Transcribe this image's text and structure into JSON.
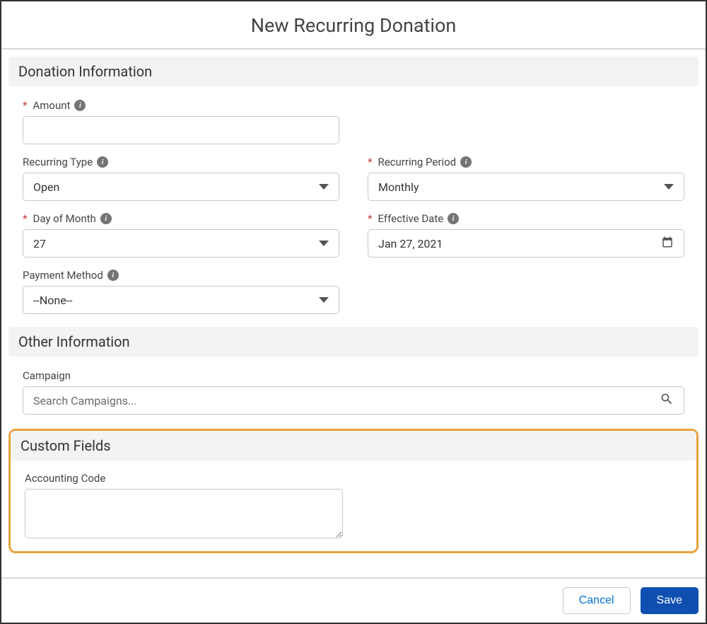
{
  "header": {
    "title": "New Recurring Donation"
  },
  "sections": {
    "donation": {
      "title": "Donation Information"
    },
    "other": {
      "title": "Other Information"
    },
    "custom": {
      "title": "Custom Fields"
    }
  },
  "fields": {
    "amount": {
      "label": "Amount",
      "required": true,
      "value": ""
    },
    "recurring_type": {
      "label": "Recurring Type",
      "value": "Open"
    },
    "recurring_period": {
      "label": "Recurring Period",
      "required": true,
      "value": "Monthly"
    },
    "day_of_month": {
      "label": "Day of Month",
      "required": true,
      "value": "27"
    },
    "effective_date": {
      "label": "Effective Date",
      "required": true,
      "value": "Jan 27, 2021"
    },
    "payment_method": {
      "label": "Payment Method",
      "value": "--None--"
    },
    "campaign": {
      "label": "Campaign",
      "placeholder": "Search Campaigns..."
    },
    "accounting_code": {
      "label": "Accounting Code",
      "value": ""
    }
  },
  "buttons": {
    "cancel": "Cancel",
    "save": "Save"
  },
  "required_mark": "*"
}
